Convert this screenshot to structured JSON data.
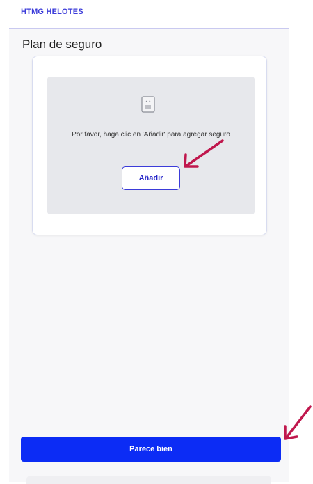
{
  "header": {
    "brand": "HTMG HELOTES"
  },
  "page": {
    "title": "Plan de seguro"
  },
  "insurance_card": {
    "empty_message": "Por favor, haga clic en 'Añadir' para agregar seguro",
    "add_button_label": "Añadir",
    "empty_icon": "document-icon"
  },
  "footer": {
    "confirm_button_label": "Parece bien"
  },
  "colors": {
    "brand": "#3b3bd9",
    "primary_button": "#0c2cf5",
    "annotation_arrow": "#c0174d"
  }
}
